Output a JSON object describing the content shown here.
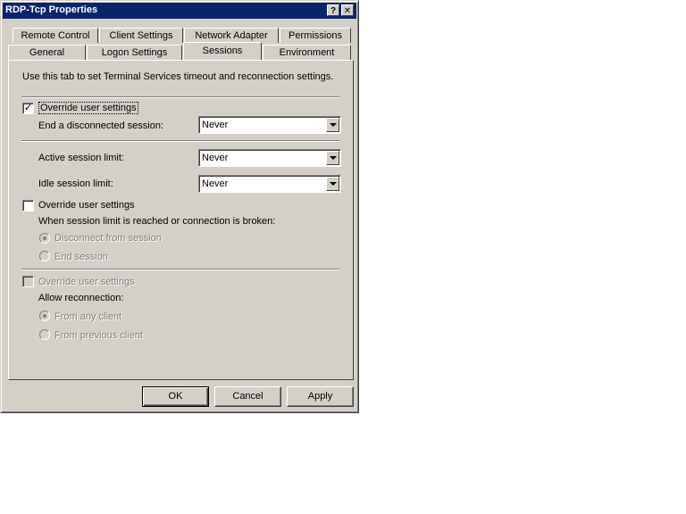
{
  "window": {
    "title": "RDP-Tcp Properties",
    "help_glyph": "?",
    "close_glyph": "✕"
  },
  "tabs_row1": [
    "Remote Control",
    "Client Settings",
    "Network Adapter",
    "Permissions"
  ],
  "tabs_row2": [
    "General",
    "Logon Settings",
    "Sessions",
    "Environment"
  ],
  "active_tab": "Sessions",
  "description": "Use this tab to set Terminal Services timeout and reconnection settings.",
  "group1": {
    "override_label": "Override user settings",
    "override_checked": true,
    "end_disconnected_label": "End a disconnected session:",
    "end_disconnected_value": "Never",
    "active_limit_label": "Active session limit:",
    "active_limit_value": "Never",
    "idle_limit_label": "Idle session limit:",
    "idle_limit_value": "Never"
  },
  "group2": {
    "override_label": "Override user settings",
    "override_checked": false,
    "prompt": "When session limit is reached or connection is broken:",
    "option_disconnect": "Disconnect from session",
    "option_end": "End session",
    "selected": "Disconnect from session"
  },
  "group3": {
    "override_label": "Override user settings",
    "override_checked": false,
    "prompt": "Allow reconnection:",
    "option_any": "From any client",
    "option_previous": "From previous client",
    "selected": "From any client"
  },
  "buttons": {
    "ok": "OK",
    "cancel": "Cancel",
    "apply": "Apply"
  }
}
